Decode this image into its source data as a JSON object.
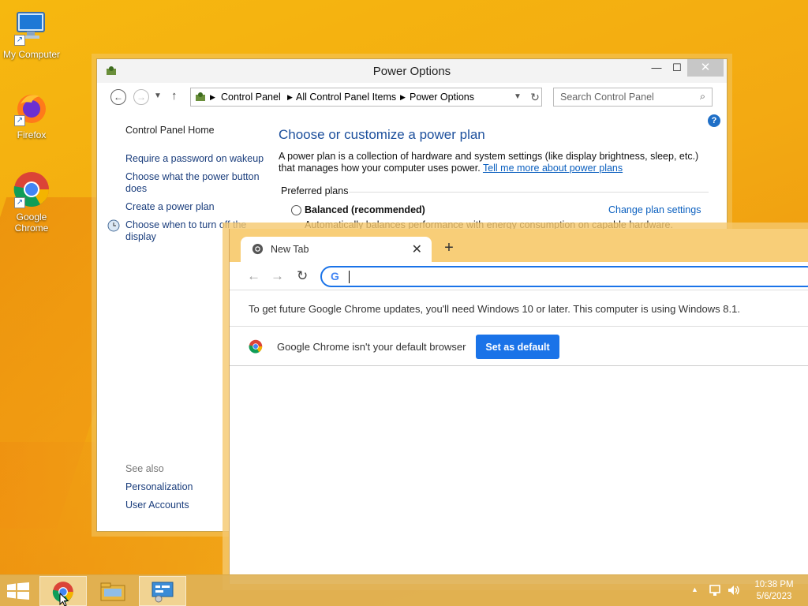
{
  "desktop": {
    "icons": [
      {
        "label": "My Computer"
      },
      {
        "label": "Firefox"
      },
      {
        "label": "Google Chrome"
      }
    ]
  },
  "power_window": {
    "title": "Power Options",
    "breadcrumb": [
      "Control Panel",
      "All Control Panel Items",
      "Power Options"
    ],
    "search_placeholder": "Search Control Panel",
    "sidebar": {
      "home": "Control Panel Home",
      "links": [
        "Require a password on wakeup",
        "Choose what the power button does",
        "Create a power plan",
        "Choose when to turn off the display"
      ],
      "see_also": "See also",
      "see_also_links": [
        "Personalization",
        "User Accounts"
      ]
    },
    "heading": "Choose or customize a power plan",
    "description": "A power plan is a collection of hardware and system settings (like display brightness, sleep, etc.) that manages how your computer uses power.",
    "description_link": "Tell me more about power plans",
    "preferred_plans": "Preferred plans",
    "plan": {
      "name": "Balanced (recommended)",
      "change_link": "Change plan settings",
      "description": "Automatically balances performance with energy consumption on capable hardware."
    }
  },
  "chrome_window": {
    "tab_title": "New Tab",
    "omnibox_value": "",
    "update_notice": "To get future Google Chrome updates, you'll need Windows 10 or later. This computer is using Windows 8.1.",
    "default_msg": "Google Chrome isn't your default browser",
    "default_btn": "Set as default"
  },
  "taskbar": {
    "time": "10:38 PM",
    "date": "5/6/2023"
  }
}
